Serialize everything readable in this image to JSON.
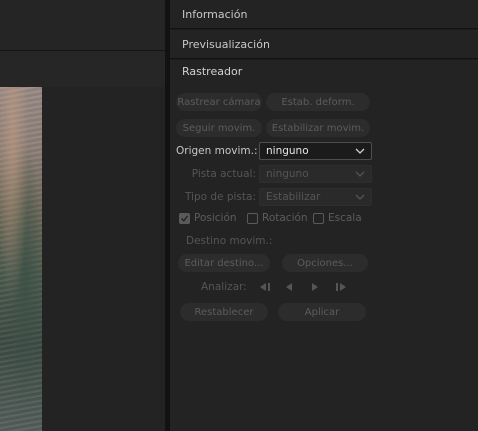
{
  "panels": {
    "info": "Información",
    "preview": "Previsualización",
    "tracker": "Rastreador"
  },
  "tracker": {
    "track_camera": "Rastrear cámara",
    "warp_stabilize": "Estab. deform.",
    "track_motion": "Seguir movim.",
    "stabilize_motion": "Estabilizar movim.",
    "motion_source_label": "Origen movim.:",
    "motion_source_value": "ninguno",
    "current_track_label": "Pista actual:",
    "current_track_value": "ninguno",
    "track_type_label": "Tipo de pista:",
    "track_type_value": "Estabilizar",
    "position": "Posición",
    "rotation": "Rotación",
    "scale": "Escala",
    "motion_target_label": "Destino movim.:",
    "edit_target": "Editar destino...",
    "options": "Opciones...",
    "analyze_label": "Analizar:",
    "reset": "Restablecer",
    "apply": "Aplicar"
  },
  "checkboxes": {
    "position_checked": true,
    "rotation_checked": false,
    "scale_checked": false
  },
  "colors": {
    "panel_bg": "#232323",
    "divider": "#121212",
    "disabled_text": "#5c5c5c",
    "active_text": "#d0d0d0"
  }
}
